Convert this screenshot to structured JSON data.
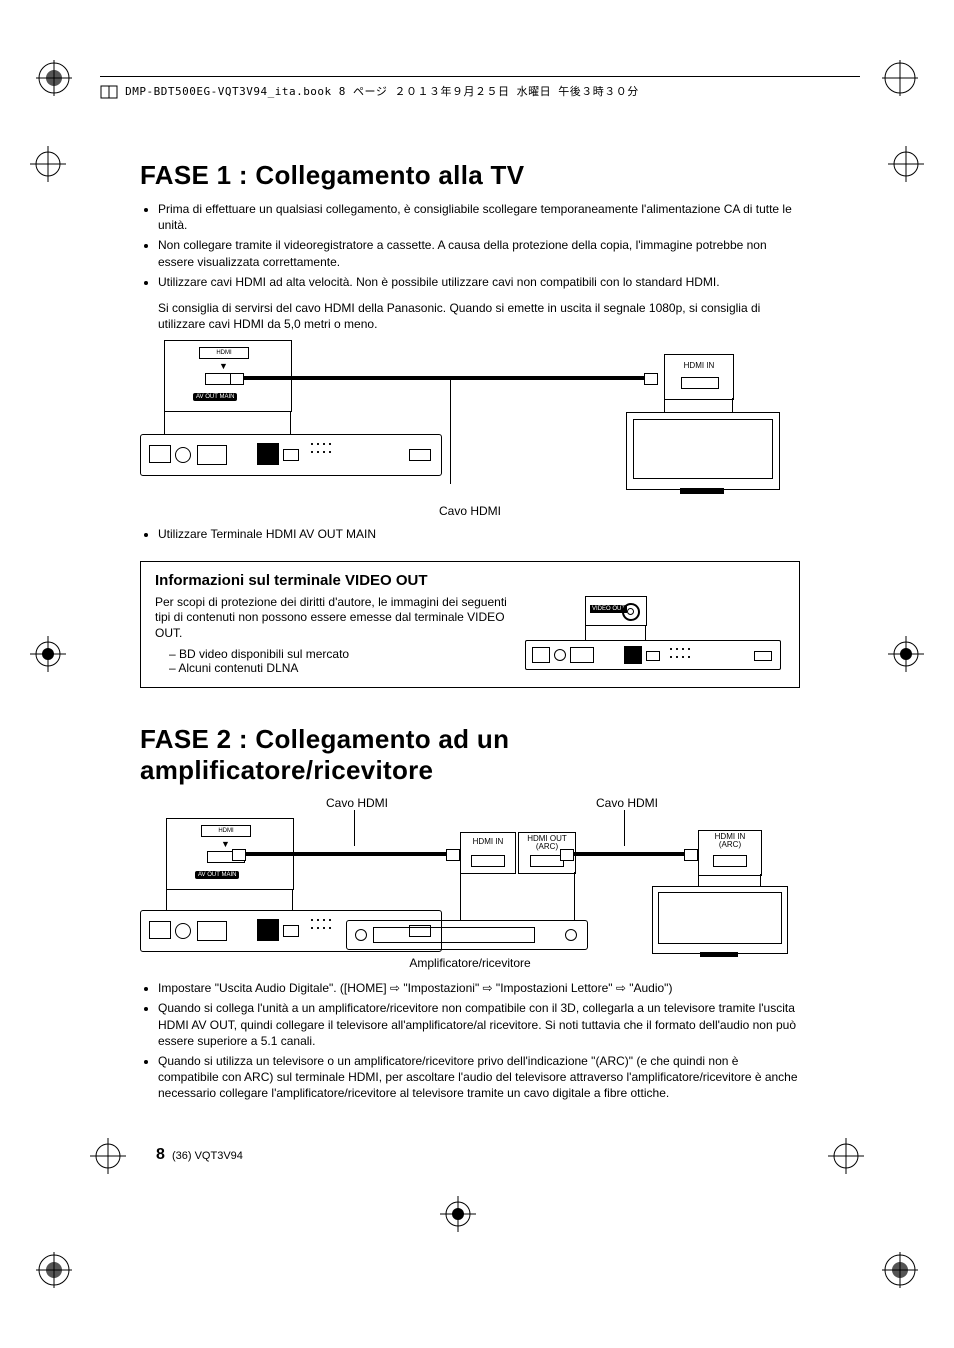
{
  "header": {
    "running": "DMP-BDT500EG-VQT3V94_ita.book  8 ページ  ２０１３年９月２５日  水曜日  午後３時３０分"
  },
  "fase1": {
    "title": "FASE 1 :  Collegamento alla TV",
    "bullets": [
      "Prima di effettuare un qualsiasi collegamento, è consigliabile scollegare temporaneamente l'alimentazione CA di tutte le unità.",
      "Non collegare tramite il videoregistratore a cassette. A causa della protezione della copia, l'immagine potrebbe non essere visualizzata correttamente.",
      "Utilizzare cavi HDMI ad alta velocità. Non è possibile utilizzare cavi non compatibili con lo standard HDMI."
    ],
    "subtext": "Si consiglia di servirsi del cavo HDMI della Panasonic. Quando si emette in uscita il segnale 1080p, si consiglia di utilizzare cavi HDMI da 5,0 metri o meno.",
    "labels": {
      "hdmi_badge": "HDMI",
      "avout_badge": "AV OUT  MAIN",
      "hdmi_in": "HDMI IN",
      "cable": "Cavo HDMI"
    },
    "post_bullet": "Utilizzare Terminale HDMI AV OUT MAIN"
  },
  "infobox": {
    "title": "Informazioni sul terminale VIDEO OUT",
    "para": "Per scopi di protezione dei diritti d'autore, le immagini dei seguenti tipi di contenuti non possono essere emesse dal terminale VIDEO OUT.",
    "items": [
      "BD video disponibili sul mercato",
      "Alcuni contenuti DLNA"
    ],
    "videoout_badge": "VIDEO OUT"
  },
  "fase2": {
    "title": "FASE 2 :  Collegamento ad un amplificatore/ricevitore",
    "labels": {
      "cable_left": "Cavo HDMI",
      "cable_right": "Cavo HDMI",
      "hdmi_in": "HDMI IN",
      "hdmi_out_arc": "HDMI OUT\n(ARC)",
      "hdmi_in_arc": "HDMI IN\n(ARC)",
      "amp_caption": "Amplificatore/ricevitore",
      "avout_badge": "AV OUT  MAIN",
      "hdmi_badge": "HDMI"
    },
    "bullets": [
      "Impostare \"Uscita Audio Digitale\". ([HOME] ⇨ \"Impostazioni\" ⇨ \"Impostazioni Lettore\" ⇨ \"Audio\")",
      "Quando si collega l'unità a un amplificatore/ricevitore non compatibile con il 3D, collegarla a un televisore tramite l'uscita HDMI AV OUT, quindi collegare il televisore all'amplificatore/al ricevitore. Si noti tuttavia che il formato dell'audio non può essere superiore a 5.1 canali.",
      "Quando si utilizza un televisore o un amplificatore/ricevitore privo dell'indicazione \"(ARC)\" (e che quindi non è compatibile con ARC) sul terminale HDMI, per ascoltare l'audio del televisore attraverso l'amplificatore/ricevitore è anche necessario collegare l'amplificatore/ricevitore al televisore tramite un cavo digitale a fibre ottiche."
    ]
  },
  "footer": {
    "page_num": "8",
    "seq": "(36)",
    "code": "VQT3V94"
  }
}
